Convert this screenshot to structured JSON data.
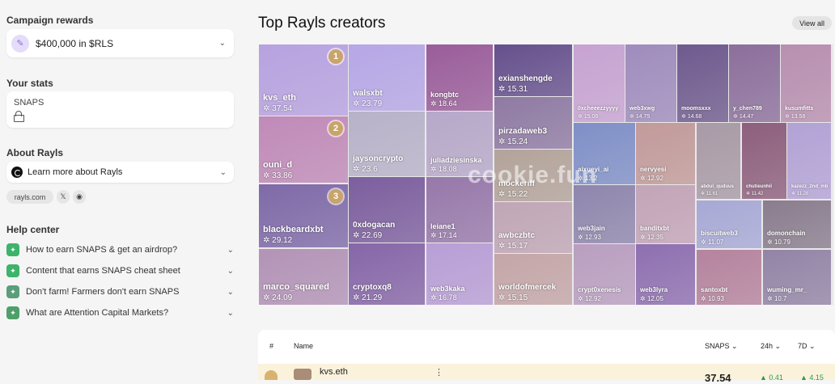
{
  "sidebar": {
    "campaign_title": "Campaign rewards",
    "campaign_reward": "$400,000 in $RLS",
    "stats_title": "Your stats",
    "stats_label": "SNAPS",
    "about_title": "About Rayls",
    "about_link": "Learn more about Rayls",
    "links": {
      "site": "rayls.com",
      "x": "𝕏",
      "discord": "◉"
    },
    "help_title": "Help center",
    "help_items": [
      {
        "label": "How to earn SNAPS & get an airdrop?",
        "color": "#3db36b"
      },
      {
        "label": "Content that earns SNAPS cheat sheet",
        "color": "#3db36b"
      },
      {
        "label": "Don't farm! Farmers don't earn SNAPS",
        "color": "#5a9e7a"
      },
      {
        "label": "What are Attention Capital Markets?",
        "color": "#4f9f6a"
      }
    ]
  },
  "main": {
    "title": "Top Rayls creators",
    "view_all": "View all",
    "watermark": "cookie.fun",
    "creators": [
      {
        "name": "kvs_eth",
        "score": "37.54",
        "rank": "1",
        "color": "#b7a2e0"
      },
      {
        "name": "ouni_d",
        "score": "33.86",
        "rank": "2",
        "color": "#c08ab8"
      },
      {
        "name": "blackbeardxbt",
        "score": "29.12",
        "rank": "3",
        "color": "#7f6aa8"
      },
      {
        "name": "marco_squared",
        "score": "24.09",
        "rank": "",
        "color": "#b393b7"
      },
      {
        "name": "walsxbt",
        "score": "23.79",
        "rank": "",
        "color": "#b6a7e6"
      },
      {
        "name": "jaysoncrypto",
        "score": "23.6",
        "rank": "",
        "color": "#b8b2c9"
      },
      {
        "name": "0xdogacan",
        "score": "22.69",
        "rank": "",
        "color": "#7c5e9e"
      },
      {
        "name": "cryptoxq8",
        "score": "21.29",
        "rank": "",
        "color": "#8666a8"
      },
      {
        "name": "kongbtc",
        "score": "18.64",
        "rank": "",
        "color": "#9a5d9a"
      },
      {
        "name": "juliadziesinska",
        "score": "18.08",
        "rank": "",
        "color": "#b6a8c9"
      },
      {
        "name": "leiane1",
        "score": "17.14",
        "rank": "",
        "color": "#9778aa"
      },
      {
        "name": "web3kaka",
        "score": "16.78",
        "rank": "",
        "color": "#b89ed6"
      },
      {
        "name": "exianshengde",
        "score": "15.31",
        "rank": "",
        "color": "#66508d"
      },
      {
        "name": "pirzadaweb3",
        "score": "15.24",
        "rank": "",
        "color": "#8f7aa3"
      },
      {
        "name": "mockeriff",
        "score": "15.22",
        "rank": "",
        "color": "#b3a39a"
      },
      {
        "name": "awbczbtc",
        "score": "15.17",
        "rank": "",
        "color": "#c0a6b6"
      },
      {
        "name": "worldofmercek",
        "score": "15.15",
        "rank": "",
        "color": "#c4a6a8"
      },
      {
        "name": "0xcheeezzyyyy",
        "score": "15.06",
        "rank": "",
        "color": "#c7a3d2"
      },
      {
        "name": "web3xwg",
        "score": "14.75",
        "rank": "",
        "color": "#9f8cbd"
      },
      {
        "name": "moomsxxx",
        "score": "14.68",
        "rank": "",
        "color": "#6f5a8e"
      },
      {
        "name": "y_chen789",
        "score": "14.47",
        "rank": "",
        "color": "#8c6f9c"
      },
      {
        "name": "kusumfitts",
        "score": "13.58",
        "rank": "",
        "color": "#b88fb0"
      },
      {
        "name": "aixueyi_ai",
        "score": "13.2",
        "rank": "",
        "color": "#7f8fc7"
      },
      {
        "name": "nervyesi",
        "score": "12.92",
        "rank": "",
        "color": "#c29a9a"
      },
      {
        "name": "abdul_quduus",
        "score": "11.61",
        "rank": "",
        "color": "#a89aa6"
      },
      {
        "name": "chutieunhii",
        "score": "11.42",
        "rank": "",
        "color": "#8d5f7d"
      },
      {
        "name": "kazezz_2nd_mb",
        "score": "11.28",
        "rank": "",
        "color": "#b3a2d6"
      },
      {
        "name": "web3jain",
        "score": "12.93",
        "rank": "",
        "color": "#8e86ad"
      },
      {
        "name": "banditxbt",
        "score": "12.35",
        "rank": "",
        "color": "#c3a4b8"
      },
      {
        "name": "biscuitweb3",
        "score": "11.07",
        "rank": "",
        "color": "#a7a9d6"
      },
      {
        "name": "domonchain",
        "score": "10.79",
        "rank": "",
        "color": "#8a7d8e"
      },
      {
        "name": "crypt0xenesis",
        "score": "12.92",
        "rank": "",
        "color": "#b99ec0"
      },
      {
        "name": "web3lyra",
        "score": "12.05",
        "rank": "",
        "color": "#8e6fb0"
      },
      {
        "name": "santoxbt",
        "score": "10.93",
        "rank": "",
        "color": "#b5839e"
      },
      {
        "name": "wuming_mr_",
        "score": "10.7",
        "rank": "",
        "color": "#9384a6"
      }
    ]
  },
  "table": {
    "col_rank": "#",
    "col_name": "Name",
    "col_snaps": "SNAPS ⌄",
    "col_24h": "24h ⌄",
    "col_7d": "7D ⌄",
    "row": {
      "name": "kvs.eth",
      "dots": "⋮",
      "snaps": "37.54",
      "d24": "▲ 0.41",
      "d7": "▲ 4.15"
    }
  }
}
